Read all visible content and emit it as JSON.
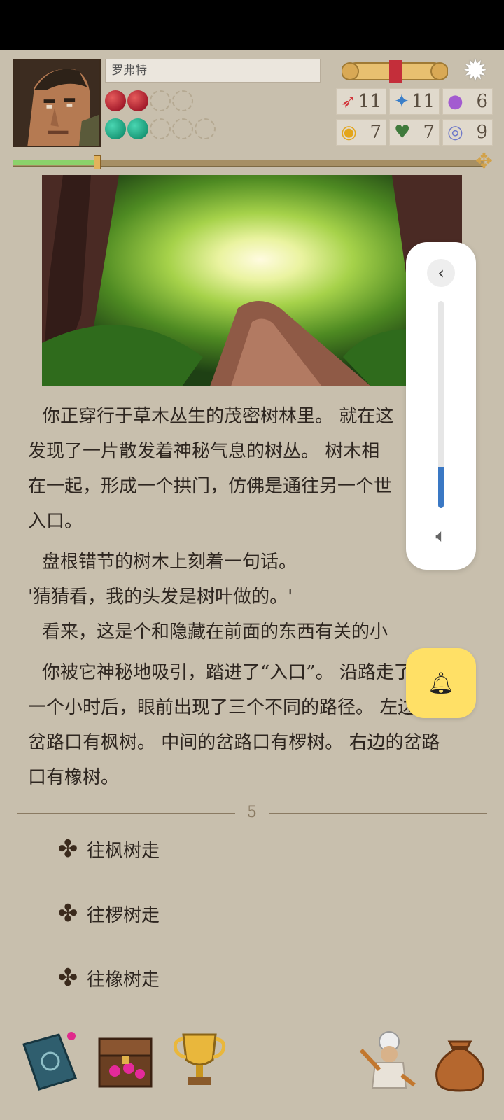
{
  "character": {
    "name": "罗弗特",
    "portrait_icon": "warrior-portrait",
    "health": {
      "filled": 2,
      "total": 4
    },
    "mana": {
      "filled": 2,
      "total": 5
    }
  },
  "stats": [
    {
      "icon": "sword-icon",
      "glyph": "➶",
      "color": "#d2343a",
      "value": "11"
    },
    {
      "icon": "feather-icon",
      "glyph": "✦",
      "color": "#3b7fc9",
      "value": "11"
    },
    {
      "icon": "potion-icon",
      "glyph": "●",
      "color": "#a35bd0",
      "value": "6"
    },
    {
      "icon": "coin-icon",
      "glyph": "◉",
      "color": "#e3a51a",
      "value": "7"
    },
    {
      "icon": "heart-icon",
      "glyph": "♥",
      "color": "#3f7a3c",
      "value": "7"
    },
    {
      "icon": "target-icon",
      "glyph": "◎",
      "color": "#6f79c9",
      "value": "9"
    }
  ],
  "progress": {
    "fraction": 0.18
  },
  "story": {
    "p1": "你正穿行于草木丛生的茂密树林里。 就在这时，你发现了一片散发着神秘气息的树丛。 树木相互交织在一起，形成一个拱门，仿佛是通往另一个世界的入口。",
    "p1_lines": [
      "你正穿行于草木丛生的茂密树林里。 就在这",
      "发现了一片散发着神秘气息的树丛。 树木相",
      "在一起，形成一个拱门，仿佛是通往另一个世",
      "入口。"
    ],
    "p2": "盘根错节的树木上刻着一句话。",
    "p3": "'猜猜看，我的头发是树叶做的。'",
    "p4": "看来，这是个和隐藏在前面的东西有关的小",
    "p5_lines": [
      "你被它神秘地吸引，踏进了“入口”。 沿路走了大约",
      "一个小时后，眼前出现了三个不同的路径。 左边的",
      "岔路口有枫树。 中间的岔路口有椤树。 右边的岔路",
      "口有橡树。"
    ]
  },
  "page_number": "5",
  "choices": [
    {
      "label": "往枫树走",
      "icon": "knot-icon"
    },
    {
      "label": "往椤树走",
      "icon": "knot-icon"
    },
    {
      "label": "往橡树走",
      "icon": "knot-icon"
    }
  ],
  "bottom_bar": [
    "spellbook-icon",
    "treasure-chest-icon",
    "trophy-icon",
    "chef-icon",
    "money-bag-icon"
  ],
  "volume": {
    "level": 0.2
  },
  "colors": {
    "background": "#c8bfad",
    "accent_yellow": "#ffe066",
    "volume_blue": "#3a78c4"
  }
}
